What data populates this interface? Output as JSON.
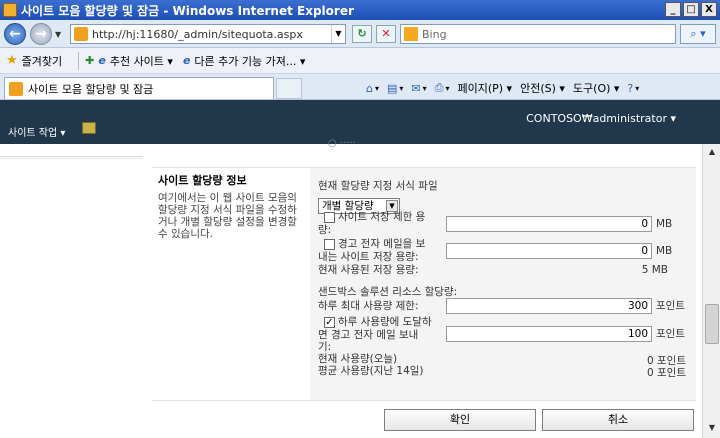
{
  "window": {
    "title": "사이트 모음 할당량 및 잠금 - Windows Internet Explorer",
    "minimize": "_",
    "maximize": "□",
    "close": "X"
  },
  "addressbar": {
    "url": "http://hj:11680/_admin/sitequota.aspx",
    "search_placeholder": "Bing"
  },
  "favorites": {
    "favorites_label": "즐겨찾기",
    "suggested_sites": "추천 사이트 ▾",
    "more_addons": "다른 추가 기능 가져... ▾"
  },
  "tab": {
    "title": "사이트 모음 할당량 및 잠금"
  },
  "commandbar": {
    "page": "페이지(P) ▾",
    "safety": "안전(S) ▾",
    "tools": "도구(O) ▾"
  },
  "sharepoint": {
    "user": "CONTOSO₩administrator ▾",
    "site_actions": "사이트 작업 ▾"
  },
  "section": {
    "title": "사이트 할당량 정보",
    "description": "여기에서는 이 웹 사이트 모음의 할당량 지정 서식 파일을 수정하거나 개별 할당량 설정을 변경할 수 있습니다."
  },
  "quota": {
    "template_label": "현재 할당량 지정 서식 파일",
    "template_value": "개별 할당량",
    "storage_limit_label": [
      "사이트 저장 제한 용",
      "량:"
    ],
    "storage_limit_value": "0",
    "storage_limit_unit": "MB",
    "warning_email_label": [
      "경고 전자 메일을 보",
      "내는 사이트 저장 용량:"
    ],
    "warning_email_value": "0",
    "warning_email_unit": "MB",
    "current_storage_label": "현재 사용된 저장 용량:",
    "current_storage_value": "5 MB",
    "sandbox_label": "샌드박스 솔루션 리소스 할당량:",
    "daily_max_label": "하루 최대 사용량 제한:",
    "daily_max_value": "300",
    "daily_max_unit": "포인트",
    "daily_warn_label": [
      "하루 사용량에 도달하",
      "면 경고 전자 메일 보내",
      "기:"
    ],
    "daily_warn_value": "100",
    "daily_warn_unit": "포인트",
    "usage_today_label": "현재 사용량(오늘)",
    "usage_today_value": "0 포인트",
    "usage_avg_label": "평균 사용량(지난 14일)",
    "usage_avg_value": "0 포인트"
  },
  "buttons": {
    "ok": "확인",
    "cancel": "취소"
  }
}
